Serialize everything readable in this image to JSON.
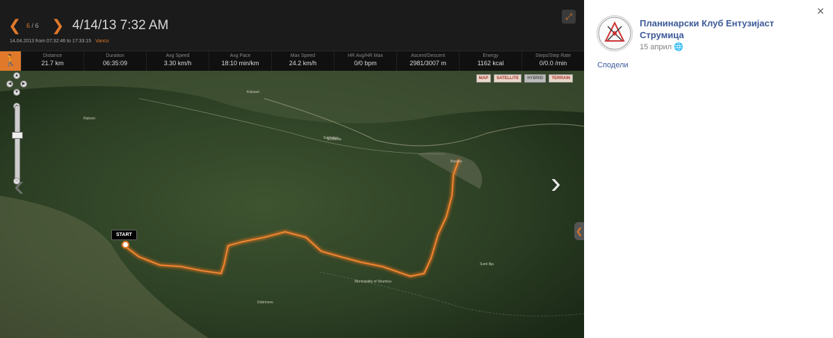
{
  "header": {
    "prev_icon": "chevron-left-icon",
    "next_icon": "chevron-right-icon",
    "counter_current": "6",
    "counter_sep": " / ",
    "counter_total": "6",
    "title": "4/14/13 7:32 AM",
    "subtitle": "14.04.2013 from 07:32:46 to 17:33:15",
    "user": "Vanco",
    "expand_icon": "expand-icon"
  },
  "stats": [
    {
      "label": "Distance",
      "value": "21.7 km"
    },
    {
      "label": "Duration",
      "value": "06:35:09"
    },
    {
      "label": "Avg Speed",
      "value": "3.30 km/h"
    },
    {
      "label": "Avg Pace",
      "value": "18:10 min/km"
    },
    {
      "label": "Max Speed",
      "value": "24.2 km/h"
    },
    {
      "label": "HR Avg/HR Max",
      "value": "0/0 bpm"
    },
    {
      "label": "Ascent/Descent",
      "value": "2981/3007 m"
    },
    {
      "label": "Energy",
      "value": "1162 kcal"
    },
    {
      "label": "Steps/Step Rate",
      "value": "0/0.0 /min"
    }
  ],
  "map": {
    "types": [
      "MAP",
      "SATELLITE",
      "HYBRID",
      "TERRAIN"
    ],
    "start_label": "START",
    "place_labels": [
      "Kokosel",
      "Rakovo",
      "Sv.Nikola",
      "Svidovica",
      "Dobrinovo",
      "Municipality of Strumica",
      "Sveti Ilija",
      "Bansko"
    ],
    "route_color": "#e0792a"
  },
  "sidebar": {
    "page_name": "Планинарски Клуб Ентузијаст Струмица",
    "date": "15 април",
    "globe_icon": "globe-icon",
    "share": "Сподели",
    "close_icon": "close-icon"
  }
}
